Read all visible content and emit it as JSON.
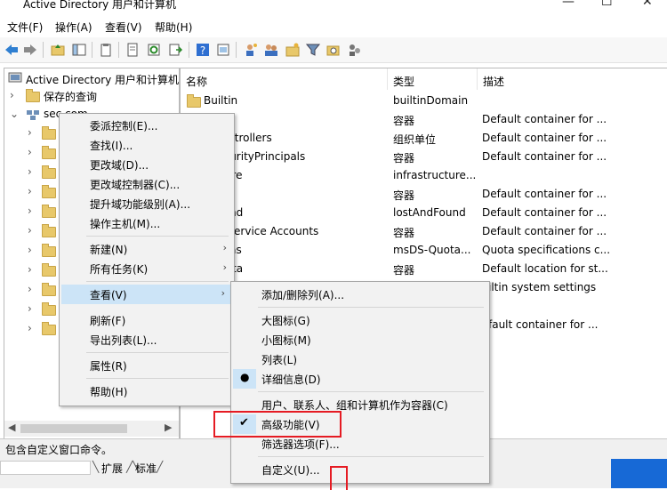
{
  "window": {
    "title": "Active Directory 用户和计算机"
  },
  "menubar": [
    "文件(F)",
    "操作(A)",
    "查看(V)",
    "帮助(H)"
  ],
  "tree": {
    "root": "Active Directory 用户和计算机",
    "saved_queries": "保存的查询",
    "domain": "sec.com"
  },
  "list": {
    "headers": [
      "名称",
      "类型",
      "描述"
    ],
    "rows": [
      {
        "name": "Builtin",
        "type": "builtinDomain",
        "desc": ""
      },
      {
        "name": "uters",
        "type": "容器",
        "desc": "Default container for ..."
      },
      {
        "name": "n Controllers",
        "type": "组织单位",
        "desc": "Default container for ..."
      },
      {
        "name": "nSecurityPrincipals",
        "type": "容器",
        "desc": "Default container for ..."
      },
      {
        "name": "ructure",
        "type": "infrastructure...",
        "desc": ""
      },
      {
        "name": "",
        "type": "容器",
        "desc": "Default container for ..."
      },
      {
        "name": "dFound",
        "type": "lostAndFound",
        "desc": "Default container for ..."
      },
      {
        "name": "ged Service Accounts",
        "type": "容器",
        "desc": "Default container for ..."
      },
      {
        "name": "Quotas",
        "type": "msDS-Quota...",
        "desc": "Quota specifications c..."
      },
      {
        "name": "m Data",
        "type": "容器",
        "desc": "Default location for st..."
      },
      {
        "name": "",
        "type": "",
        "desc": "iltin system settings"
      },
      {
        "name": "",
        "type": "",
        "desc": ""
      },
      {
        "name": "",
        "type": "",
        "desc": "fault container for ..."
      }
    ]
  },
  "context_menu": {
    "items": [
      "委派控制(E)...",
      "查找(I)...",
      "更改域(D)...",
      "更改域控制器(C)...",
      "提升域功能级别(A)...",
      "操作主机(M)...",
      "新建(N)",
      "所有任务(K)",
      "查看(V)",
      "刷新(F)",
      "导出列表(L)...",
      "属性(R)",
      "帮助(H)"
    ]
  },
  "submenu": {
    "items": [
      "添加/删除列(A)...",
      "大图标(G)",
      "小图标(M)",
      "列表(L)",
      "详细信息(D)",
      "用户、联系人、组和计算机作为容器(C)",
      "高级功能(V)",
      "筛选器选项(F)...",
      "自定义(U)..."
    ]
  },
  "status": {
    "text": "包含自定义窗口命令。"
  },
  "tabs": [
    "扩展",
    "标准"
  ],
  "colors": {
    "highlight": "#cce4f7",
    "annotation_red": "#e51b23"
  }
}
